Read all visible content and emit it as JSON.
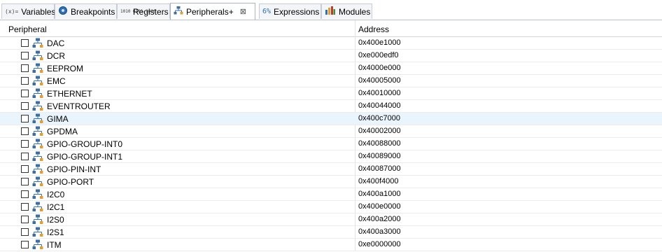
{
  "tabs": [
    {
      "icon": "variables-icon",
      "label": "Variables",
      "icon_text": "(x)="
    },
    {
      "icon": "breakpoints-icon",
      "label": "Breakpoints"
    },
    {
      "icon": "registers-icon",
      "label": "Registers",
      "icon_text": "1010 0101 1010"
    },
    {
      "icon": "peripherals-icon",
      "label": "Peripherals+",
      "close": "⊠",
      "active": true
    },
    {
      "icon": "expressions-icon",
      "label": "Expressions",
      "icon_text": "6%"
    },
    {
      "icon": "modules-icon",
      "label": "Modules"
    }
  ],
  "table": {
    "headers": {
      "peripheral": "Peripheral",
      "address": "Address"
    },
    "highlighted_row": "GIMA",
    "rows": [
      {
        "name": "DAC",
        "address": "0x400e1000"
      },
      {
        "name": "DCR",
        "address": "0xe000edf0"
      },
      {
        "name": "EEPROM",
        "address": "0x4000e000"
      },
      {
        "name": "EMC",
        "address": "0x40005000"
      },
      {
        "name": "ETHERNET",
        "address": "0x40010000"
      },
      {
        "name": "EVENTROUTER",
        "address": "0x40044000"
      },
      {
        "name": "GIMA",
        "address": "0x400c7000"
      },
      {
        "name": "GPDMA",
        "address": "0x40002000"
      },
      {
        "name": "GPIO-GROUP-INT0",
        "address": "0x40088000"
      },
      {
        "name": "GPIO-GROUP-INT1",
        "address": "0x40089000"
      },
      {
        "name": "GPIO-PIN-INT",
        "address": "0x40087000"
      },
      {
        "name": "GPIO-PORT",
        "address": "0x400f4000"
      },
      {
        "name": "I2C0",
        "address": "0x400a1000"
      },
      {
        "name": "I2C1",
        "address": "0x400e0000"
      },
      {
        "name": "I2S0",
        "address": "0x400a2000"
      },
      {
        "name": "I2S1",
        "address": "0x400a3000"
      },
      {
        "name": "ITM",
        "address": "0xe0000000"
      }
    ]
  },
  "colors": {
    "tab_border": "#c7cdd6",
    "row_highlight": "#eaf4fc",
    "peripheral_icon": "#3b6ea5",
    "peripheral_icon_accent": "#e0a030"
  }
}
